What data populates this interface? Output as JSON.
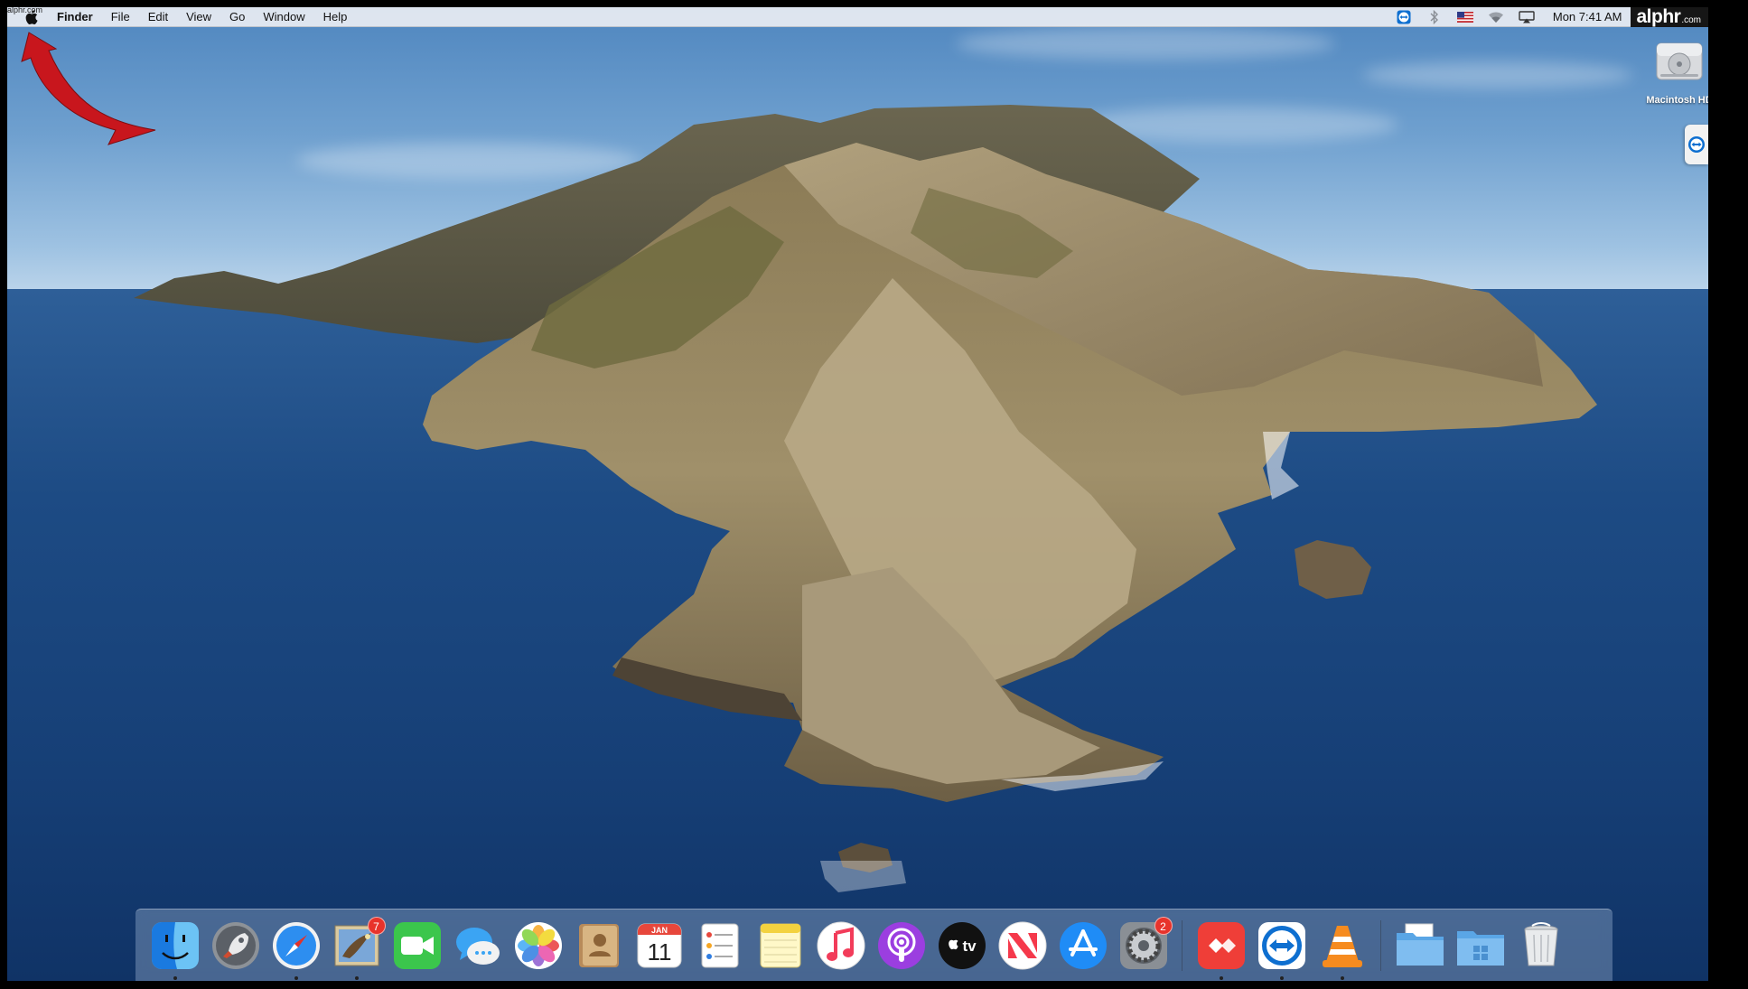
{
  "menubar": {
    "app_name": "Finder",
    "menus": [
      "File",
      "Edit",
      "View",
      "Go",
      "Window",
      "Help"
    ],
    "clock": "Mon 7:41 AM",
    "status_icons": [
      "teamviewer-icon",
      "bluetooth-icon",
      "us-flag-icon",
      "wifi-icon",
      "airplay-icon"
    ],
    "brand": "alphr",
    "brand_suffix": ".com",
    "corner_text": "alphr.com"
  },
  "desktop": {
    "drive_label": "Macintosh HD"
  },
  "dock": {
    "apps": [
      {
        "name": "Finder",
        "icon": "finder-icon",
        "running": true
      },
      {
        "name": "Launchpad",
        "icon": "launchpad-icon",
        "running": false
      },
      {
        "name": "Safari",
        "icon": "safari-icon",
        "running": true
      },
      {
        "name": "Mail",
        "icon": "mail-icon",
        "running": true,
        "badge": "7"
      },
      {
        "name": "FaceTime",
        "icon": "facetime-icon",
        "running": false
      },
      {
        "name": "Messages",
        "icon": "messages-icon",
        "running": false
      },
      {
        "name": "Photos",
        "icon": "photos-icon",
        "running": false
      },
      {
        "name": "Contacts",
        "icon": "contacts-icon",
        "running": false
      },
      {
        "name": "Calendar",
        "icon": "calendar-icon",
        "running": false,
        "month": "JAN",
        "day": "11"
      },
      {
        "name": "Reminders",
        "icon": "reminders-icon",
        "running": false
      },
      {
        "name": "Notes",
        "icon": "notes-icon",
        "running": false
      },
      {
        "name": "Music",
        "icon": "music-icon",
        "running": false
      },
      {
        "name": "Podcasts",
        "icon": "podcasts-icon",
        "running": false
      },
      {
        "name": "TV",
        "icon": "tv-icon",
        "running": false,
        "label": "tv"
      },
      {
        "name": "News",
        "icon": "news-icon",
        "running": false
      },
      {
        "name": "App Store",
        "icon": "app-store-icon",
        "running": false
      },
      {
        "name": "System Preferences",
        "icon": "system-preferences-icon",
        "running": false,
        "badge": "2"
      },
      {
        "name": "AnyDesk",
        "icon": "anydesk-icon",
        "running": true
      },
      {
        "name": "TeamViewer",
        "icon": "teamviewer-icon",
        "running": true
      },
      {
        "name": "VLC",
        "icon": "vlc-icon",
        "running": true
      },
      {
        "name": "Documents",
        "icon": "documents-folder-icon",
        "running": false
      },
      {
        "name": "Applications",
        "icon": "windows-folder-icon",
        "running": false
      },
      {
        "name": "Trash",
        "icon": "trash-icon",
        "running": false
      }
    ]
  },
  "colors": {
    "arrow": "#c8161d",
    "badge": "#e8332b",
    "menubar": "#e8ecf2"
  }
}
